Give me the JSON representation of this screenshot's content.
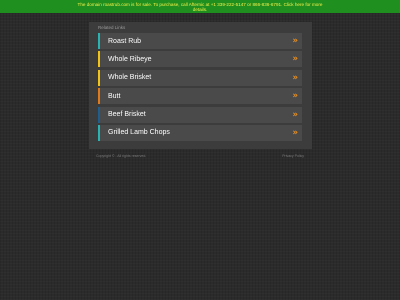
{
  "banner": {
    "line1": "The domain roastrub.com is for sale. To purchase, call Afternic at +1 339-222-5147 or 866-836-6791. Click here for more",
    "line2": "details."
  },
  "panel": {
    "heading": "Related Links",
    "links": [
      {
        "label": "Roast Rub",
        "color": "#2ab3b3"
      },
      {
        "label": "Whole Ribeye",
        "color": "#f2c418"
      },
      {
        "label": "Whole Brisket",
        "color": "#f2c418"
      },
      {
        "label": "Butt",
        "color": "#e07a1a"
      },
      {
        "label": "Beef Brisket",
        "color": "#1f5f8f"
      },
      {
        "label": "Grilled Lamb Chops",
        "color": "#2ab3b3"
      }
    ],
    "arrow_glyph": "»",
    "arrow_color": "#f29422"
  },
  "footer": {
    "copyright": "Copyright © . All rights reserved.",
    "privacy": "Privacy Policy"
  }
}
